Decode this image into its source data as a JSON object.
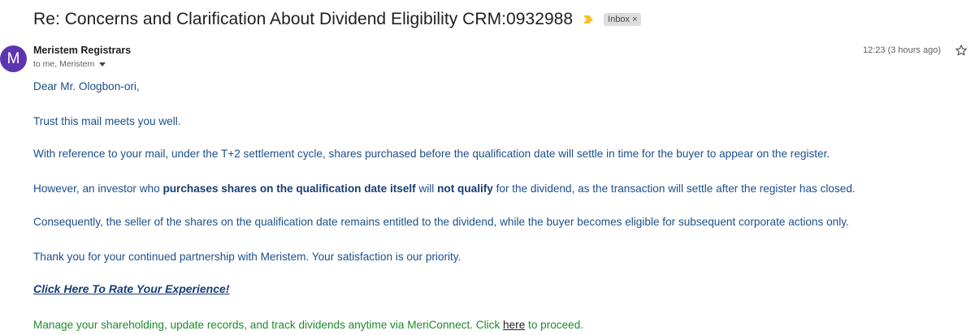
{
  "email": {
    "subject": "Re: Concerns and Clarification About Dividend Eligibility CRM:0932988",
    "label": "Inbox",
    "label_remove": "×",
    "avatar_initial": "M",
    "sender_name": "Meristem Registrars",
    "recipients": "to me, Meristem",
    "timestamp": "12:23 (3 hours ago)",
    "colors": {
      "avatar": "#5e35b1",
      "importance_marker": "#f6c026",
      "body_text": "#1b4f8c",
      "footer_text": "#1e8a2c"
    },
    "icons": {
      "importance": "importance-marker-icon",
      "star": "star-icon",
      "recipients_toggle": "caret-down-icon"
    }
  },
  "body": {
    "greeting": "Dear Mr. Ologbon-ori,",
    "p1": "Trust this mail meets you well.",
    "p2": "With reference to your mail, under the T+2 settlement cycle, shares purchased before the qualification date will settle in time for the buyer to appear on the register.",
    "p3_a": "However, an investor who ",
    "p3_b": "purchases shares on the qualification date itself",
    "p3_c": " will ",
    "p3_d": "not qualify",
    "p3_e": " for the dividend, as the transaction will settle after the register has closed.",
    "p4": "Consequently, the seller of the shares on the qualification date remains entitled to the dividend, while the buyer becomes eligible for subsequent corporate actions only.",
    "p5": "Thank you for your continued partnership with Meristem. Your satisfaction is our priority.",
    "rate_link": "Click Here To Rate Your Experience!",
    "footer_a": "Manage your shareholding, update records, and track dividends anytime via MeriConnect. Click ",
    "footer_link": "here",
    "footer_b": " to proceed."
  }
}
